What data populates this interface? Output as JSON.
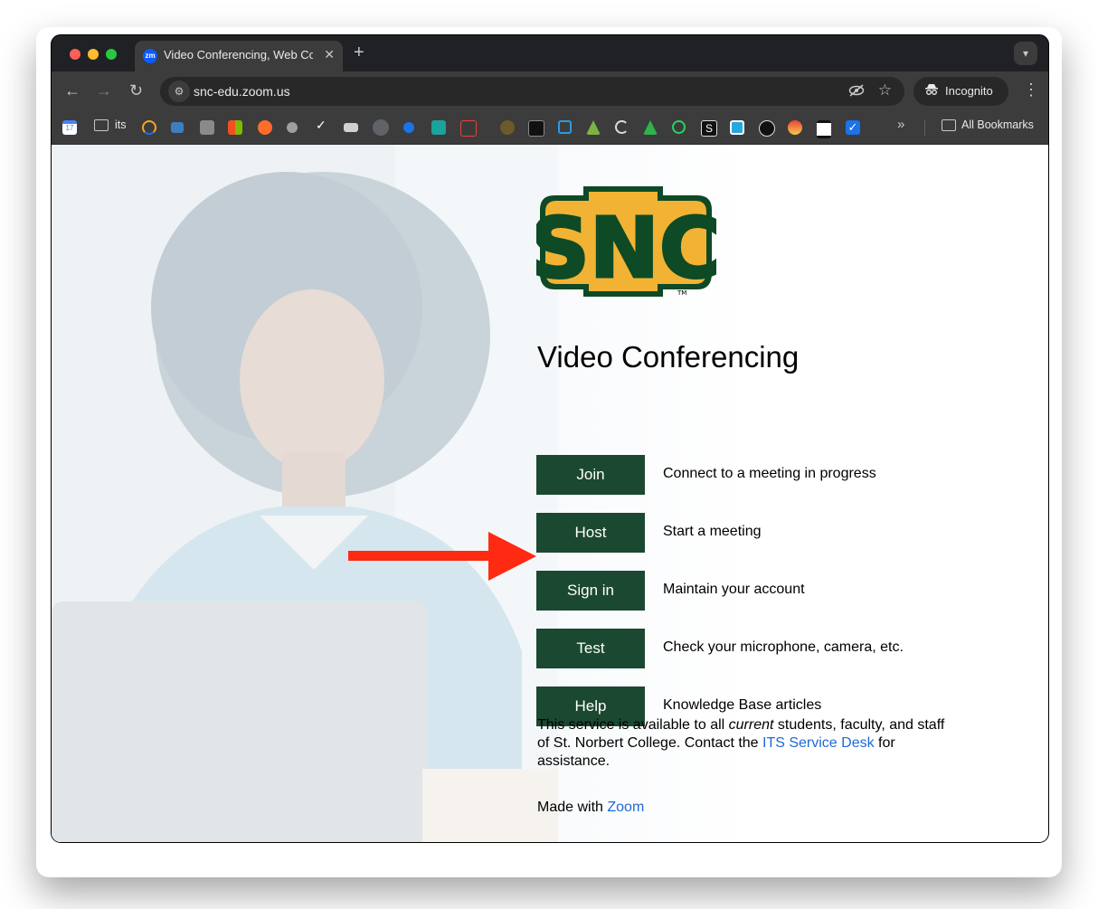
{
  "browser": {
    "tab": {
      "favicon_text": "zm",
      "title": "Video Conferencing, Web Con"
    },
    "address": {
      "url": "snc-edu.zoom.us"
    },
    "incognito_label": "Incognito",
    "bookmarks": {
      "folder_label": "its",
      "all_bookmarks_label": "All Bookmarks",
      "icon_names": [
        "google-calendar-icon",
        "folder-icon",
        "bookmark-icon",
        "bookmark-icon",
        "bookmark-icon",
        "microsoft-icon",
        "cpanel-icon",
        "bookmark-icon",
        "checkmark-icon",
        "bookmark-icon",
        "bookmark-icon",
        "bookmark-icon",
        "bookmark-icon",
        "bookmark-icon",
        "bookmark-icon",
        "vscode-icon",
        "bookmark-icon",
        "bookmark-icon",
        "google-drive-icon",
        "whatsapp-icon",
        "bookmark-icon",
        "bookmark-icon",
        "bookmark-icon",
        "bookmark-icon",
        "bookmark-icon",
        "bookmark-icon"
      ]
    }
  },
  "page": {
    "logo_text": "SNC",
    "logo_tm": "TM",
    "heading": "Video Conferencing",
    "actions": [
      {
        "label": "Join",
        "description": "Connect to a meeting in progress"
      },
      {
        "label": "Host",
        "description": "Start a meeting"
      },
      {
        "label": "Sign in",
        "description": "Maintain your account"
      },
      {
        "label": "Test",
        "description": "Check your microphone, camera, etc."
      },
      {
        "label": "Help",
        "description": "Knowledge Base articles"
      }
    ],
    "note": {
      "part1": "This service is available to all ",
      "emphasis": "current",
      "part2": " students, faculty, and staff of St. Norbert College. Contact the ",
      "link": "ITS Service Desk",
      "part3": " for assistance."
    },
    "made_with": {
      "prefix": "Made with ",
      "link": "Zoom"
    }
  },
  "colors": {
    "button_bg": "#1b4830",
    "link": "#1e6ad6",
    "arrow": "#ff2a12",
    "logo_green": "#0e4a25",
    "logo_gold": "#f2b233"
  }
}
